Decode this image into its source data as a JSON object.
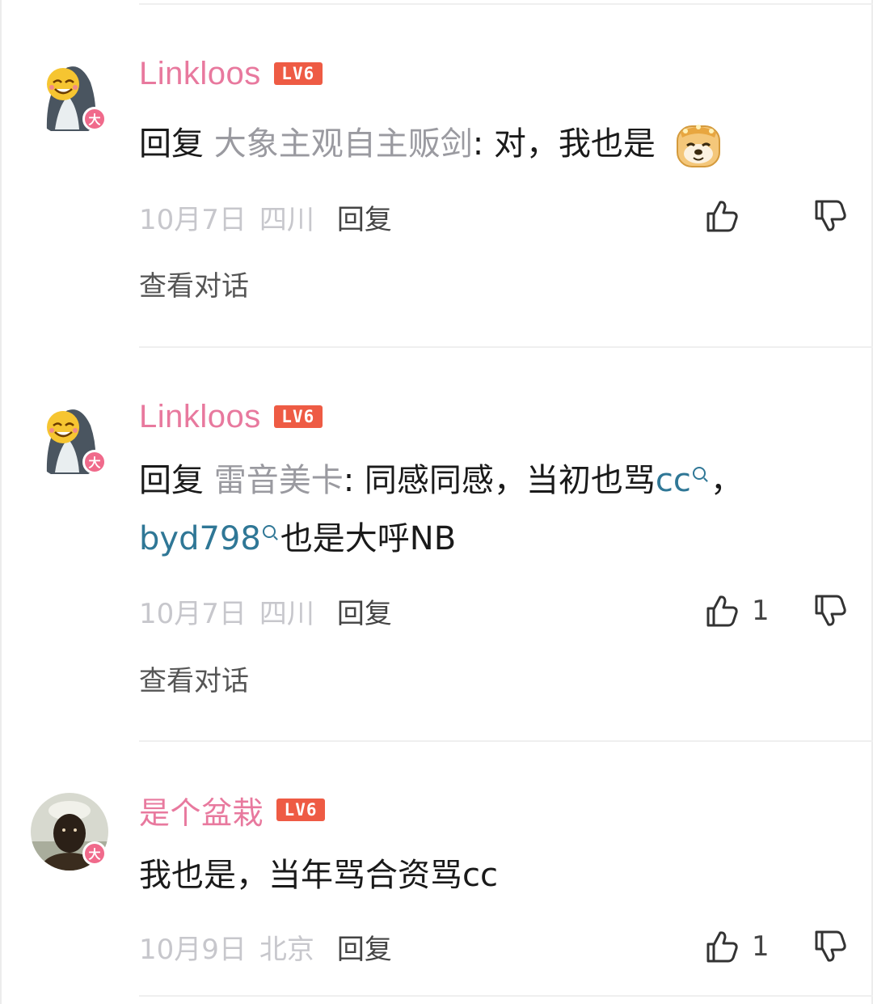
{
  "comments": [
    {
      "username": "Linkloos",
      "level": "LV6",
      "avatar_badge": "大",
      "reply_prefix": "回复",
      "reply_target": "大象主观自主贩剑",
      "text_after_target": ": 对，我也是",
      "sticker": "doge-sticker-icon",
      "date": "10月7日",
      "location": "四川",
      "reply_label": "回复",
      "like_count": "",
      "view_conversation": "查看对话"
    },
    {
      "username": "Linkloos",
      "level": "LV6",
      "avatar_badge": "大",
      "reply_prefix": "回复",
      "reply_target": "雷音美卡",
      "text_part1": ": 同感同感，当初也骂",
      "topic1": "cc",
      "text_part2": "，",
      "topic2": "byd798",
      "text_part3": "也是大呼NB",
      "date": "10月7日",
      "location": "四川",
      "reply_label": "回复",
      "like_count": "1",
      "view_conversation": "查看对话"
    },
    {
      "username": "是个盆栽",
      "level": "LV6",
      "avatar_badge": "大",
      "text": "我也是，当年骂合资骂cc",
      "date": "10月9日",
      "location": "北京",
      "reply_label": "回复",
      "like_count": "1"
    }
  ],
  "colors": {
    "username": "#e8799e",
    "level_badge": "#ee5b44",
    "topic_link": "#2f7796",
    "reply_target": "#9a9aa0",
    "meta": "#c7c7cc"
  }
}
